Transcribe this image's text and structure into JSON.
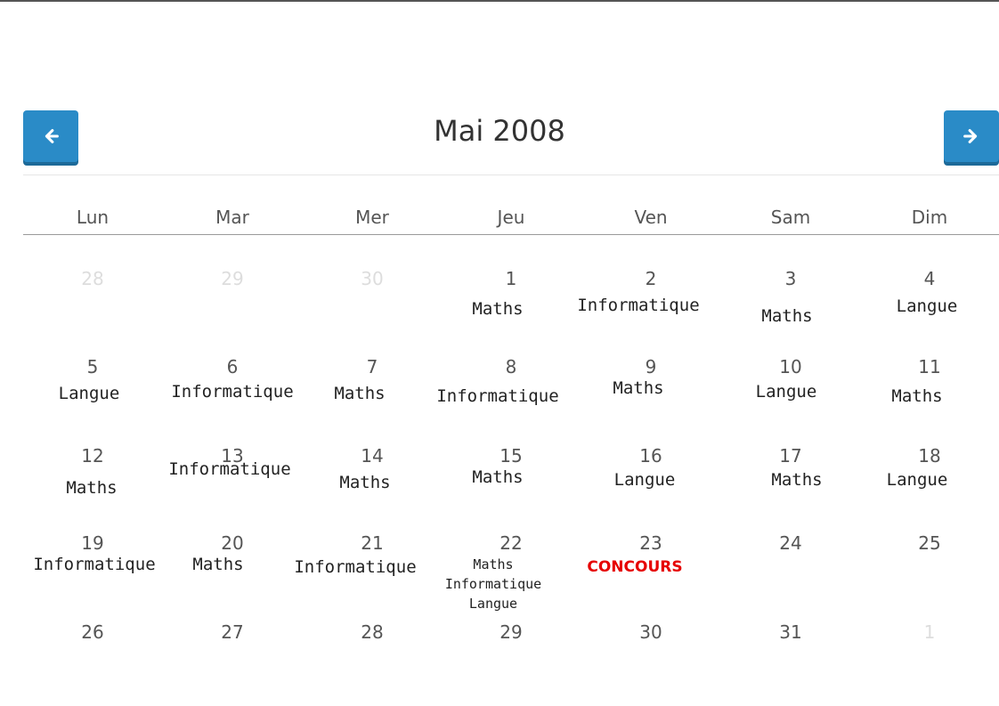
{
  "calendar": {
    "title": "Mai 2008",
    "prev_icon": "arrow-left-icon",
    "next_icon": "arrow-right-icon",
    "weekdays": [
      "Lun",
      "Mar",
      "Mer",
      "Jeu",
      "Ven",
      "Sam",
      "Dim"
    ],
    "weeks": [
      [
        {
          "day": "28",
          "other": true
        },
        {
          "day": "29",
          "other": true
        },
        {
          "day": "30",
          "other": true
        },
        {
          "day": "1",
          "events": [
            "Maths"
          ]
        },
        {
          "day": "2",
          "events": [
            "Informatique"
          ]
        },
        {
          "day": "3",
          "events": [
            "Maths"
          ]
        },
        {
          "day": "4",
          "events": [
            "Langue"
          ]
        }
      ],
      [
        {
          "day": "5",
          "events": [
            "Langue"
          ]
        },
        {
          "day": "6",
          "events": [
            "Informatique"
          ]
        },
        {
          "day": "7",
          "events": [
            "Maths"
          ]
        },
        {
          "day": "8",
          "events": [
            "Informatique"
          ]
        },
        {
          "day": "9",
          "events": [
            "Maths"
          ]
        },
        {
          "day": "10",
          "events": [
            "Langue"
          ]
        },
        {
          "day": "11",
          "events": [
            "Maths"
          ]
        }
      ],
      [
        {
          "day": "12",
          "events": [
            "Maths"
          ]
        },
        {
          "day": "13",
          "events": [
            "Informatique"
          ]
        },
        {
          "day": "14",
          "events": [
            "Maths"
          ]
        },
        {
          "day": "15",
          "events": [
            "Maths"
          ]
        },
        {
          "day": "16",
          "events": [
            "Langue"
          ]
        },
        {
          "day": "17",
          "events": [
            "Maths"
          ]
        },
        {
          "day": "18",
          "events": [
            "Langue"
          ]
        }
      ],
      [
        {
          "day": "19",
          "events": [
            "Informatique"
          ]
        },
        {
          "day": "20",
          "events": [
            "Maths"
          ]
        },
        {
          "day": "21",
          "events": [
            "Informatique"
          ]
        },
        {
          "day": "22",
          "events": [
            "Maths",
            "Informatique",
            "Langue"
          ]
        },
        {
          "day": "23",
          "events": [
            "CONCOURS"
          ]
        },
        {
          "day": "24"
        },
        {
          "day": "25"
        }
      ],
      [
        {
          "day": "26"
        },
        {
          "day": "27"
        },
        {
          "day": "28"
        },
        {
          "day": "29"
        },
        {
          "day": "30"
        },
        {
          "day": "31"
        },
        {
          "day": "1",
          "other": true
        }
      ]
    ],
    "colors": {
      "button": "#2a8bc7",
      "concours": "#e60000",
      "other_month": "#dddddd"
    }
  }
}
